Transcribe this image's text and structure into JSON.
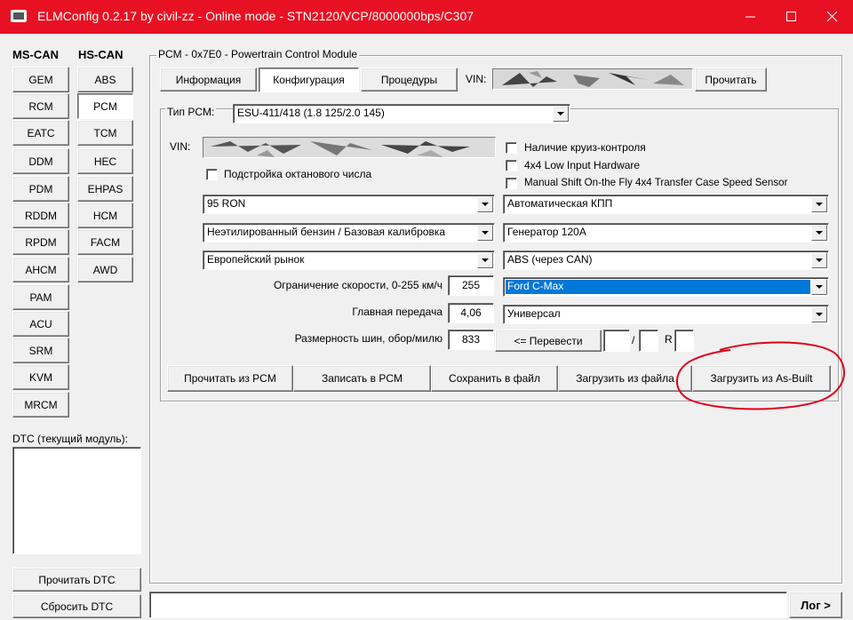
{
  "window": {
    "title": "ELMConfig 0.2.17 by civil-zz - Online mode - STN2120/VCP/8000000bps/C307",
    "minimize": "—",
    "maximize": "☐",
    "close": "✕"
  },
  "modules": {
    "ms_header": "MS-CAN",
    "hs_header": "HS-CAN",
    "ms": [
      "GEM",
      "RCM",
      "EATC",
      "DDM",
      "PDM",
      "RDDM",
      "RPDM",
      "AHCM",
      "PAM",
      "ACU",
      "SRM",
      "KVM",
      "MRCM"
    ],
    "hs": [
      "ABS",
      "PCM",
      "TCM",
      "HEC",
      "EHPAS",
      "HCM",
      "FACM",
      "AWD"
    ],
    "selected_hs": "PCM"
  },
  "dtc": {
    "label": "DTC (текущий модуль):",
    "read_button": "Прочитать DTC",
    "reset_button": "Сбросить DTC"
  },
  "pcm_group": {
    "title": "PCM - 0x7E0 - Powertrain Control Module",
    "tabs": [
      "Информация",
      "Конфигурация",
      "Процедуры"
    ],
    "active_tab": "Конфигурация",
    "vin_label": "VIN:",
    "read_button": "Прочитать"
  },
  "config": {
    "type_label": "Тип PCM:",
    "type_value": "ESU-411/418 (1.8 125/2.0 145)",
    "vin_label": "VIN:",
    "octane_check": "Подстройка октанового числа",
    "checks_right": [
      "Наличие круиз-контроля",
      "4x4 Low Input Hardware",
      "Manual Shift On-the Fly 4x4 Transfer Case Speed Sensor"
    ],
    "left_combos": [
      "95 RON",
      "Неэтилированный бензин / Базовая калибровка",
      "Европейский рынок"
    ],
    "right_combos": [
      "Автоматическая КПП",
      "Генератор 120A",
      "ABS (через CAN)",
      "Ford C-Max",
      "Универсал"
    ],
    "speed_limit_label": "Ограничение скорости, 0-255 км/ч",
    "speed_limit_value": "255",
    "main_gear_label": "Главная передача",
    "main_gear_value": "4,06",
    "tire_label": "Размерность шин, обор/милю",
    "tire_value": "833",
    "convert_button": "<= Перевести",
    "slash": "/",
    "r_label": "R"
  },
  "actions": {
    "read_pcm": "Прочитать из PCM",
    "write_pcm": "Записать в PCM",
    "save_file": "Сохранить в файл",
    "load_file": "Загрузить из файла",
    "load_asbuilt": "Загрузить из As-Built"
  },
  "footer": {
    "log_button": "Лог >"
  },
  "colors": {
    "titlebar": "#e81123",
    "selection": "#0078d7",
    "annotation": "#e0001b"
  }
}
